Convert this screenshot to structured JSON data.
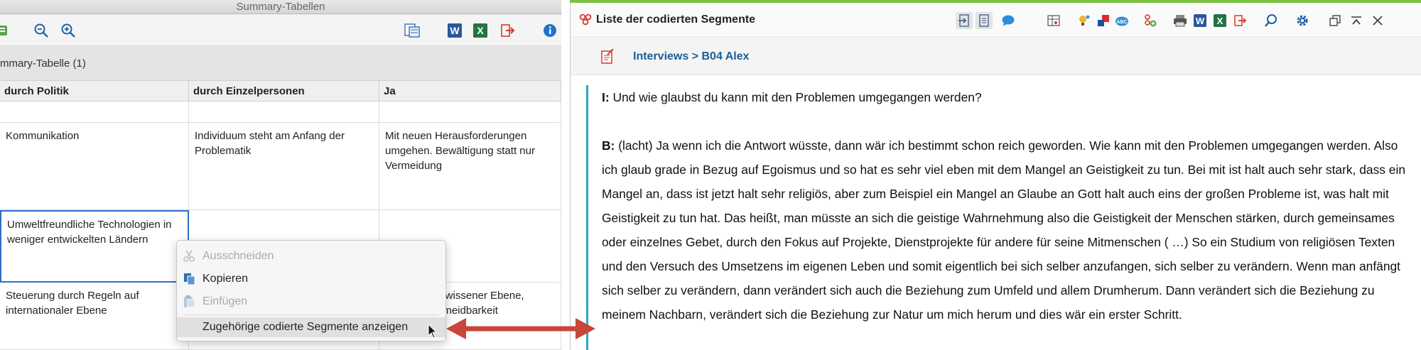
{
  "left_window": {
    "title": "Summary-Tabellen",
    "summary_label": "mmary-Tabelle (1)",
    "columns": [
      "durch Politik",
      "durch Einzelpersonen",
      "Ja"
    ],
    "rows": [
      [
        "",
        "",
        ""
      ],
      [
        "Kommunikation",
        "Individuum steht am Anfang der Problematik",
        "Mit neuen Herausforderungen umgehen. Bewältigung statt nur Vermeidung"
      ],
      [
        "Umweltfreundliche Technologien in weniger entwickelten Ländern",
        "",
        ""
      ],
      [
        "Steuerung durch Regeln auf internationaler Ebene",
        "",
        "gewissener Ebene, ermeidbarkeit"
      ]
    ],
    "toolbar_icons": [
      "table-icon",
      "zoom-out-icon",
      "zoom-in-icon",
      "export-table-icon",
      "word-icon",
      "excel-icon",
      "exit-icon",
      "info-icon"
    ]
  },
  "context_menu": {
    "items": [
      {
        "label": "Ausschneiden",
        "enabled": false,
        "icon": "scissors-icon"
      },
      {
        "label": "Kopieren",
        "enabled": true,
        "icon": "copy-icon"
      },
      {
        "label": "Einfügen",
        "enabled": false,
        "icon": "paste-icon"
      },
      {
        "label": "Zugehörige codierte Segmente anzeigen",
        "enabled": true,
        "icon": ""
      }
    ]
  },
  "right_window": {
    "title": "Liste der codierten Segmente",
    "breadcrumb": "Interviews > B04 Alex",
    "paragraph_interviewer_label": "I:",
    "paragraph_interviewer_text": " Und wie glaubst du kann mit den Problemen umgegangen werden?",
    "paragraph_b_label": "B:",
    "paragraph_b_text": " (lacht) Ja wenn ich die Antwort wüsste, dann wär ich bestimmt schon reich geworden. Wie kann mit den Problemen umgegangen werden. Also ich glaub grade in Bezug auf Egoismus und so hat es sehr viel eben mit dem Mangel an Geistigkeit zu tun. Bei mit ist halt auch sehr stark, dass ein Mangel an, dass ist jetzt halt sehr religiös, aber zum Beispiel ein Mangel an Glaube an Gott halt auch eins der großen Probleme ist, was halt mit Geistigkeit zu tun hat. Das heißt, man müsste an sich die geistige Wahrnehmung also die Geistigkeit der Menschen stärken, durch gemeinsames oder einzelnes Gebet, durch den Fokus auf Projekte, Dienstprojekte für andere für seine Mitmenschen ( …) So ein Studium von religiösen Texten und den Versuch des Umsetzens im eigenen Leben und somit eigentlich bei sich selber anzufangen, sich selber zu verändern. Wenn man anfängt sich selber zu verändern, dann verändert sich auch die Beziehung zum Umfeld und allem Drumherum. Dann verändert sich die Beziehung zu meinem Nachbarn, verändert sich die Beziehung zur Natur um mich herum und dies wär ein erster Schritt.",
    "colors": {
      "accent_green": "#7bc142",
      "breadcrumb_blue": "#1d5d95",
      "segment_line": "#2ba7c4"
    }
  },
  "arrow": {
    "color": "#c8463a"
  }
}
